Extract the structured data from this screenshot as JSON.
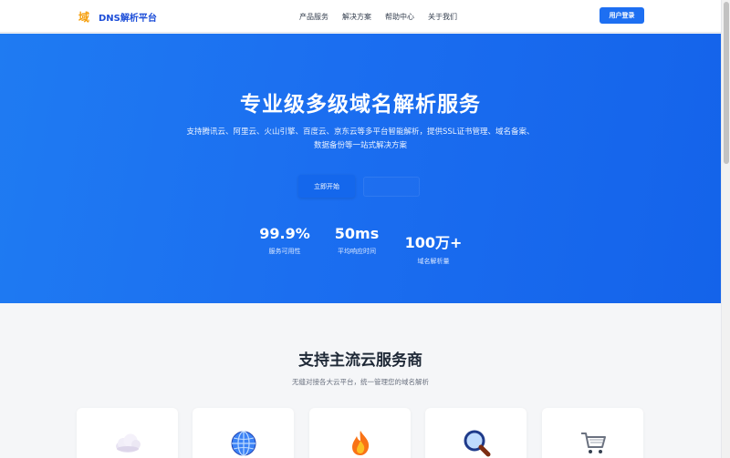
{
  "nav": {
    "logo_icon": "域",
    "logo_text": "DNS解析平台",
    "links": [
      "产品服务",
      "解决方案",
      "帮助中心",
      "关于我们"
    ],
    "login": "用户登录"
  },
  "hero": {
    "title": "专业级多级域名解析服务",
    "desc_line1": "支持腾讯云、阿里云、火山引擎、百度云、京东云等多平台智能解析，提供SSL证书管理、域名备案、",
    "desc_line2": "数据备份等一站式解决方案",
    "start_button": "立即开始",
    "stats": [
      {
        "value": "99.9%",
        "label": "服务可用性"
      },
      {
        "value": "50ms",
        "label": "平均响应时间"
      },
      {
        "value": "100万+",
        "label": "域名解析量"
      }
    ]
  },
  "providers": {
    "title": "支持主流云服务商",
    "subtitle": "无缝对接各大云平台，统一管理您的域名解析",
    "cards": [
      {
        "icon": "cloud-icon"
      },
      {
        "icon": "globe-icon"
      },
      {
        "icon": "fire-icon"
      },
      {
        "icon": "magnifier-icon"
      },
      {
        "icon": "shopping-cart-icon"
      }
    ]
  },
  "colors": {
    "brand": "#1d6ff2",
    "hero_gradient_start": "#1f7bf2",
    "hero_gradient_end": "#1463ea",
    "logo_accent": "#f59e0b"
  }
}
